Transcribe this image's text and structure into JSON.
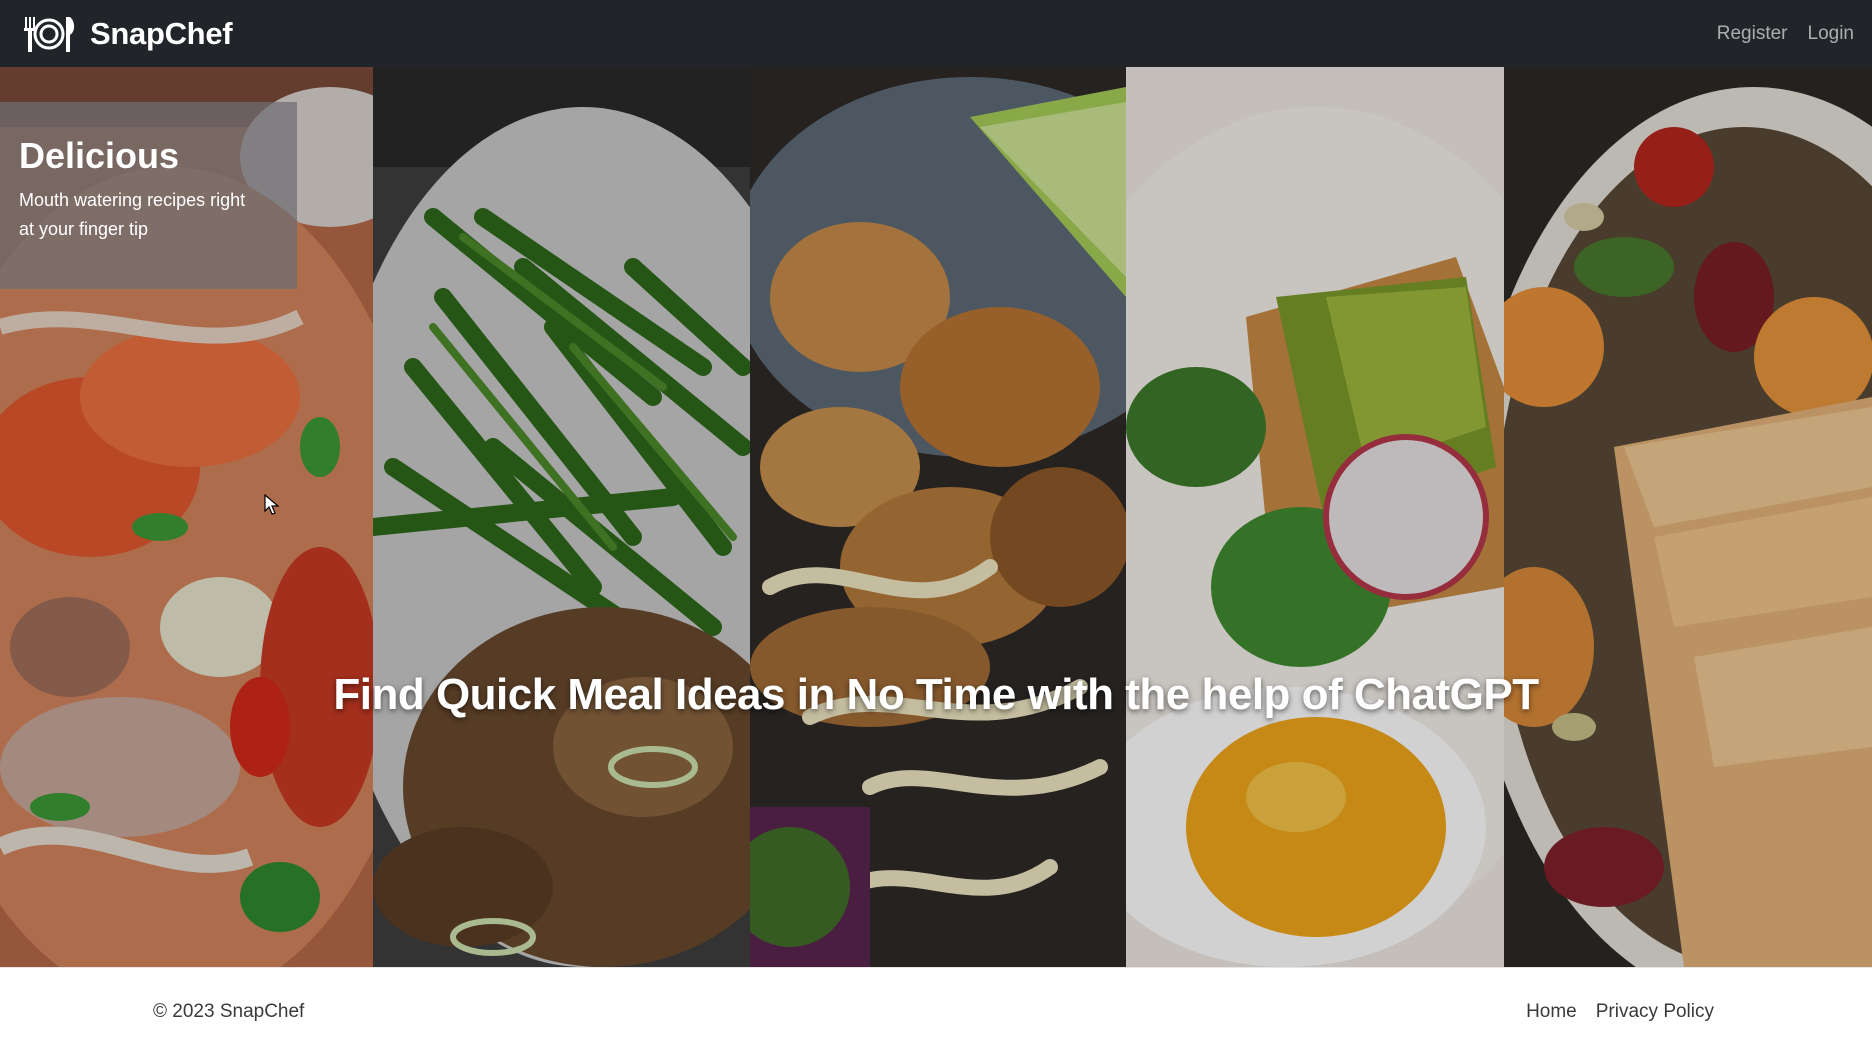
{
  "navbar": {
    "brand_name": "SnapChef",
    "brand_icon": "plate-fork-knife-icon",
    "links": [
      "Register",
      "Login"
    ]
  },
  "hero": {
    "caption_title": "Delicious",
    "caption_text": "Mouth watering recipes right at your finger tip",
    "heading": "Find Quick Meal Ideas in No Time with the help of ChatGPT",
    "panels": [
      "shrimp-noodle-photo",
      "green-beans-photo",
      "grilled-shrimp-photo",
      "avocado-egg-toast-photo",
      "chicken-grain-salad-photo"
    ]
  },
  "footer": {
    "copyright": "© 2023 SnapChef",
    "links": [
      "Home",
      "Privacy Policy"
    ]
  },
  "colors": {
    "navbar_bg": "#212529",
    "footer_bg": "#ffffff"
  }
}
